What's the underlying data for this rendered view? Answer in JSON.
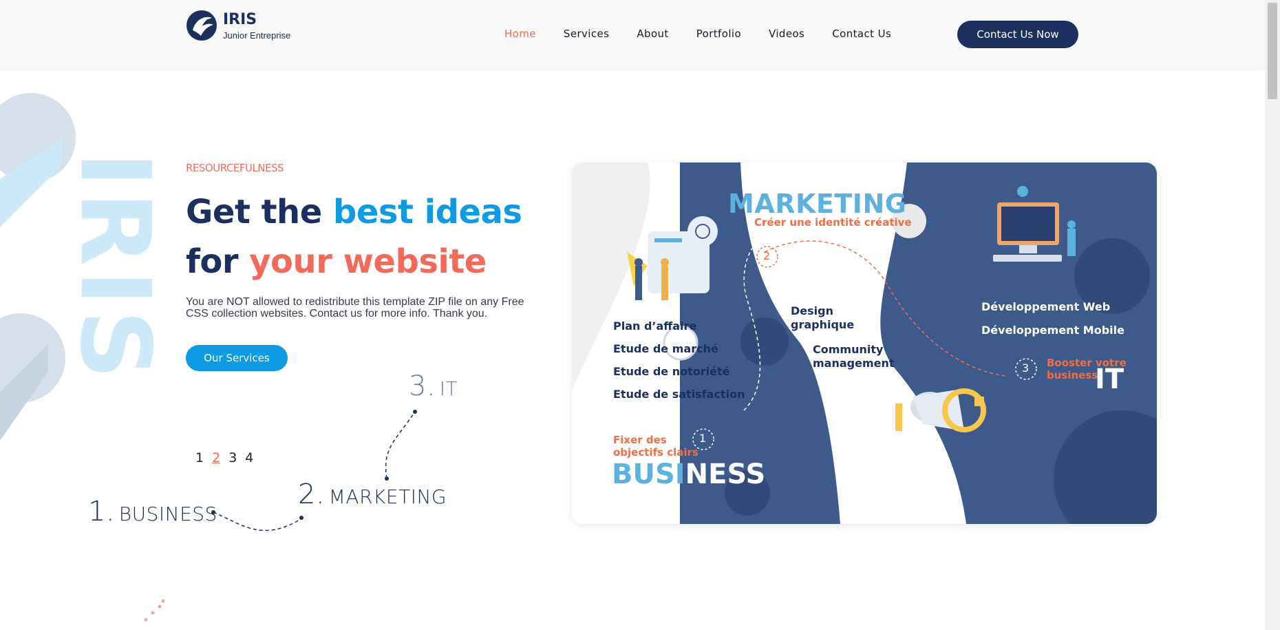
{
  "header": {
    "logo_title": "IRIS",
    "logo_subtitle": "Junior Entreprise",
    "nav": [
      {
        "label": "Home",
        "active": true
      },
      {
        "label": "Services",
        "active": false
      },
      {
        "label": "About",
        "active": false
      },
      {
        "label": "Portfolio",
        "active": false
      },
      {
        "label": "Videos",
        "active": false
      },
      {
        "label": "Contact Us",
        "active": false
      }
    ],
    "cta_label": "Contact Us Now"
  },
  "hero": {
    "vertical_word": "IRIS",
    "eyebrow": "RESOURCEFULNESS",
    "headline_part1": "Get the ",
    "headline_highlight1": "best ideas",
    "headline_part2": "for ",
    "headline_highlight2": "your website",
    "description": "You are NOT allowed to redistribute this template ZIP file on any Free CSS collection websites. Contact us for more info. Thank you.",
    "button_label": "Our Services",
    "pager": [
      "1",
      "2",
      "3",
      "4"
    ],
    "pager_active": 1,
    "steps": [
      {
        "num": "1.",
        "label": "BUSINESS"
      },
      {
        "num": "2.",
        "label": "MARKETING"
      },
      {
        "num": "3.",
        "label": "IT"
      }
    ]
  },
  "illustration": {
    "marketing_title": "MARKETING",
    "marketing_subtitle": "Créer une identité créative",
    "business_items": [
      "Plan d’affaire",
      "Etude de marché",
      "Etude de notoriété",
      "Etude de satisfaction"
    ],
    "business_goal": [
      "Fixer des",
      "objectifs clairs"
    ],
    "business_title_a": "BUSI",
    "business_title_b": "NESS",
    "marketing_items": [
      [
        "Design",
        "graphique"
      ],
      [
        "Community",
        "management"
      ]
    ],
    "it_items": [
      "Développement Web",
      "Développement Mobile"
    ],
    "it_goal": [
      "Booster votre",
      "business"
    ],
    "it_title": "IT",
    "step_numbers": [
      "1",
      "2",
      "3"
    ]
  },
  "colors": {
    "navy": "#1c2f5e",
    "coral": "#f36a5a",
    "blue": "#0d9be5",
    "card_navy": "#3d5a8a",
    "orange": "#f26d43",
    "light_blue": "#5bb2e0"
  }
}
